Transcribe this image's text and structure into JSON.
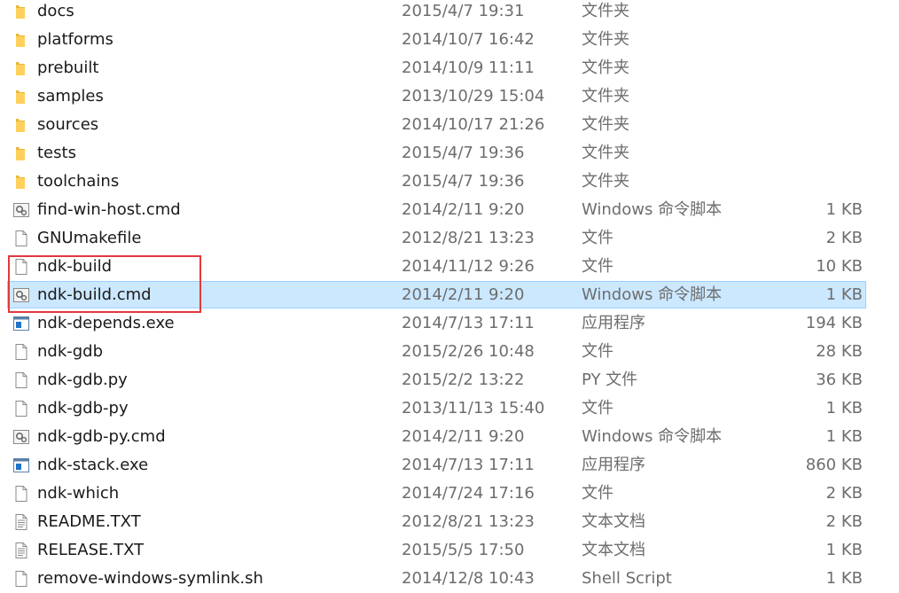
{
  "colors": {
    "selection_bg": "#cce8ff",
    "selection_border": "#99d1ff",
    "annotation_box": "#e0393e",
    "folder": "#ffd15c",
    "meta_text": "#6d6d6d"
  },
  "files": [
    {
      "name": "docs",
      "date": "2015/4/7 19:31",
      "type": "文件夹",
      "size": "",
      "icon": "folder-icon"
    },
    {
      "name": "platforms",
      "date": "2014/10/7 16:42",
      "type": "文件夹",
      "size": "",
      "icon": "folder-icon"
    },
    {
      "name": "prebuilt",
      "date": "2014/10/9 11:11",
      "type": "文件夹",
      "size": "",
      "icon": "folder-icon"
    },
    {
      "name": "samples",
      "date": "2013/10/29 15:04",
      "type": "文件夹",
      "size": "",
      "icon": "folder-icon"
    },
    {
      "name": "sources",
      "date": "2014/10/17 21:26",
      "type": "文件夹",
      "size": "",
      "icon": "folder-icon"
    },
    {
      "name": "tests",
      "date": "2015/4/7 19:36",
      "type": "文件夹",
      "size": "",
      "icon": "folder-icon"
    },
    {
      "name": "toolchains",
      "date": "2015/4/7 19:36",
      "type": "文件夹",
      "size": "",
      "icon": "folder-icon"
    },
    {
      "name": "find-win-host.cmd",
      "date": "2014/2/11 9:20",
      "type": "Windows 命令脚本",
      "size": "1 KB",
      "icon": "cmd-script-icon"
    },
    {
      "name": "GNUmakefile",
      "date": "2012/8/21 13:23",
      "type": "文件",
      "size": "2 KB",
      "icon": "file-icon"
    },
    {
      "name": "ndk-build",
      "date": "2014/11/12 9:26",
      "type": "文件",
      "size": "10 KB",
      "icon": "file-icon"
    },
    {
      "name": "ndk-build.cmd",
      "date": "2014/2/11 9:20",
      "type": "Windows 命令脚本",
      "size": "1 KB",
      "icon": "cmd-script-icon",
      "selected": true
    },
    {
      "name": "ndk-depends.exe",
      "date": "2014/7/13 17:11",
      "type": "应用程序",
      "size": "194 KB",
      "icon": "exe-icon"
    },
    {
      "name": "ndk-gdb",
      "date": "2015/2/26 10:48",
      "type": "文件",
      "size": "28 KB",
      "icon": "file-icon"
    },
    {
      "name": "ndk-gdb.py",
      "date": "2015/2/2 13:22",
      "type": "PY 文件",
      "size": "36 KB",
      "icon": "file-icon"
    },
    {
      "name": "ndk-gdb-py",
      "date": "2013/11/13 15:40",
      "type": "文件",
      "size": "1 KB",
      "icon": "file-icon"
    },
    {
      "name": "ndk-gdb-py.cmd",
      "date": "2014/2/11 9:20",
      "type": "Windows 命令脚本",
      "size": "1 KB",
      "icon": "cmd-script-icon"
    },
    {
      "name": "ndk-stack.exe",
      "date": "2014/7/13 17:11",
      "type": "应用程序",
      "size": "860 KB",
      "icon": "exe-icon"
    },
    {
      "name": "ndk-which",
      "date": "2014/7/24 17:16",
      "type": "文件",
      "size": "2 KB",
      "icon": "file-icon"
    },
    {
      "name": "README.TXT",
      "date": "2012/8/21 13:23",
      "type": "文本文档",
      "size": "2 KB",
      "icon": "text-document-icon"
    },
    {
      "name": "RELEASE.TXT",
      "date": "2015/5/5 17:50",
      "type": "文本文档",
      "size": "1 KB",
      "icon": "text-document-icon"
    },
    {
      "name": "remove-windows-symlink.sh",
      "date": "2014/12/8 10:43",
      "type": "Shell Script",
      "size": "1 KB",
      "icon": "file-icon"
    }
  ]
}
